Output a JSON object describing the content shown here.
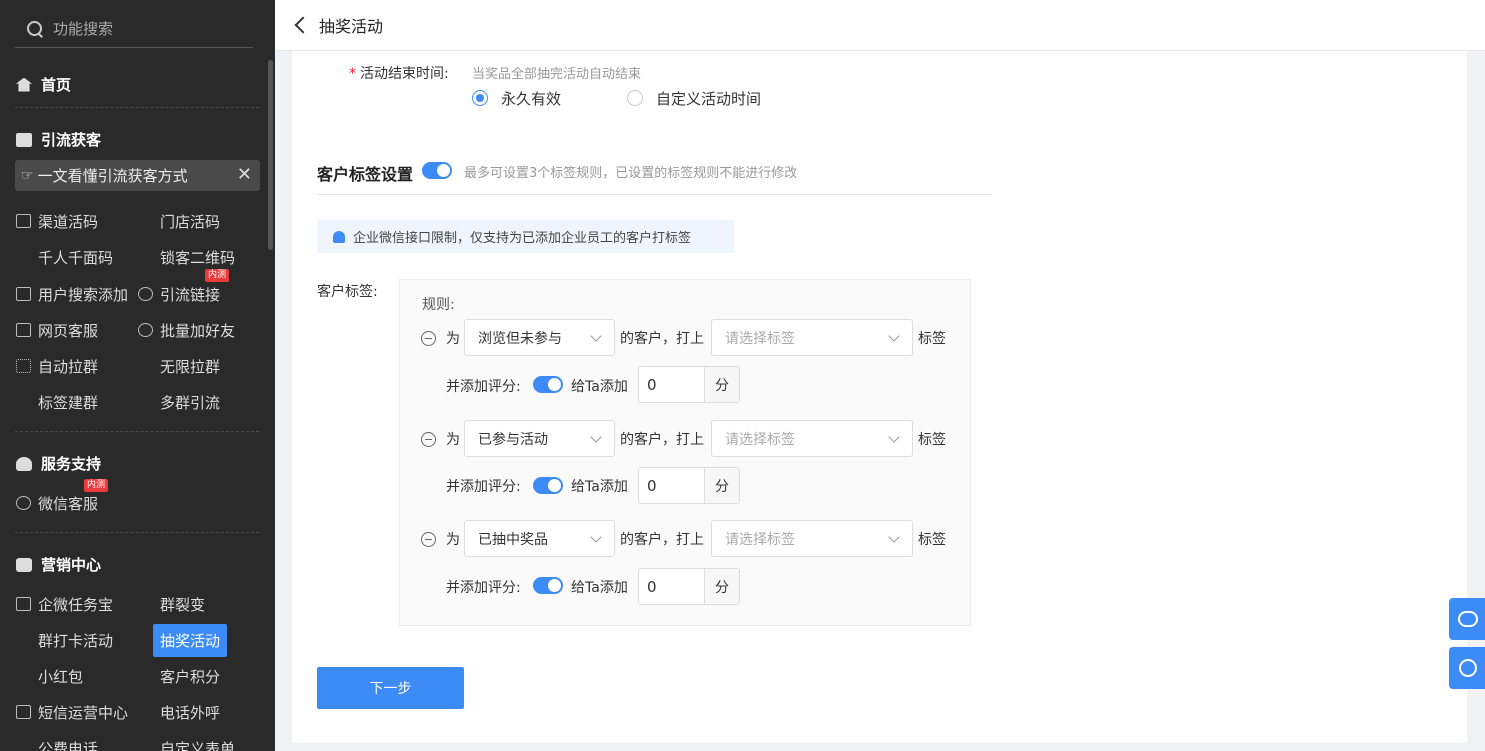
{
  "sidebar": {
    "search_placeholder": "功能搜索",
    "home": "首页",
    "sections": {
      "traffic": "引流获客",
      "service": "服务支持",
      "marketing": "营销中心"
    },
    "promo": "一文看懂引流获客方式",
    "items": {
      "channel_code": "渠道活码",
      "store_code": "门店活码",
      "personal_code": "千人千面码",
      "lock_qr": "锁客二维码",
      "user_search_add": "用户搜索添加",
      "traffic_link": "引流链接",
      "web_service": "网页客服",
      "batch_add_friends": "批量加好友",
      "auto_group": "自动拉群",
      "unlimited_group": "无限拉群",
      "tag_group": "标签建群",
      "multi_group": "多群引流",
      "wechat_service": "微信客服",
      "task_treasure": "企微任务宝",
      "group_fission": "群裂变",
      "group_checkin": "群打卡活动",
      "lottery": "抽奖活动",
      "red_packet": "小红包",
      "customer_points": "客户积分",
      "sms_center": "短信运营中心",
      "phone_outbound": "电话外呼",
      "public_phone": "公费电话",
      "custom_form": "自定义表单"
    },
    "badge_beta": "内测"
  },
  "topbar": {
    "title": "抽奖活动"
  },
  "form": {
    "end_time_label": "活动结束时间:",
    "end_time_hint": "当奖品全部抽完活动自动结束",
    "radio_forever": "永久有效",
    "radio_custom": "自定义活动时间",
    "tag_section_title": "客户标签设置",
    "tag_section_hint": "最多可设置3个标签规则，已设置的标签规则不能进行修改",
    "notice": "企业微信接口限制，仅支持为已添加企业员工的客户打标签",
    "customer_tag_label": "客户标签:",
    "rules_label": "规则:",
    "rules": [
      {
        "for": "为",
        "condition": "浏览但未参与",
        "customer_text": "的客户，打上",
        "tag_placeholder": "请选择标签",
        "tag_suffix": "标签",
        "score_label": "并添加评分:",
        "give_text": "给Ta添加",
        "score": "0",
        "unit": "分"
      },
      {
        "for": "为",
        "condition": "已参与活动",
        "customer_text": "的客户，打上",
        "tag_placeholder": "请选择标签",
        "tag_suffix": "标签",
        "score_label": "并添加评分:",
        "give_text": "给Ta添加",
        "score": "0",
        "unit": "分"
      },
      {
        "for": "为",
        "condition": "已抽中奖品",
        "customer_text": "的客户，打上",
        "tag_placeholder": "请选择标签",
        "tag_suffix": "标签",
        "score_label": "并添加评分:",
        "give_text": "给Ta添加",
        "score": "0",
        "unit": "分"
      }
    ],
    "next_button": "下一步"
  },
  "colors": {
    "accent": "#3d8bf7",
    "sidebar_bg": "#2a2a2a",
    "badge": "#e93b3b"
  }
}
